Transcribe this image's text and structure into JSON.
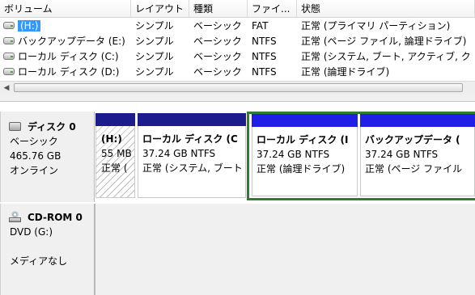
{
  "columns": [
    "ボリューム",
    "レイアウト",
    "種類",
    "ファイ...",
    "状態"
  ],
  "volumes": [
    {
      "name": "(H:)",
      "layout": "シンプル",
      "type": "ベーシック",
      "fs": "FAT",
      "status": "正常 (プライマリ パーティション)",
      "selected": true
    },
    {
      "name": "バックアップデータ (E:)",
      "layout": "シンプル",
      "type": "ベーシック",
      "fs": "NTFS",
      "status": "正常 (ページ ファイル, 論理ドライブ)"
    },
    {
      "name": "ローカル ディスク (C:)",
      "layout": "シンプル",
      "type": "ベーシック",
      "fs": "NTFS",
      "status": "正常 (システム, ブート, アクティブ, ク"
    },
    {
      "name": "ローカル ディスク (D:)",
      "layout": "シンプル",
      "type": "ベーシック",
      "fs": "NTFS",
      "status": "正常 (論理ドライブ)"
    }
  ],
  "disk0": {
    "title": "ディスク 0",
    "kind": "ベーシック",
    "size": "465.76 GB",
    "state": "オンライン",
    "partitions": [
      {
        "name": "(H:)",
        "size": "55 MB",
        "status": "正常 (",
        "bar": "#1c1c8c",
        "hatched": true
      },
      {
        "name": "ローカル ディスク (C",
        "size": "37.24 GB NTFS",
        "status": "正常 (システム, ブート",
        "bar": "#1c1c8c"
      },
      {
        "name": "ローカル ディスク (I",
        "size": "37.24 GB NTFS",
        "status": "正常 (論理ドライブ)",
        "bar": "#1f1fe6"
      },
      {
        "name": "バックアップデータ (",
        "size": "37.24 GB NTFS",
        "status": "正常 (ページ ファイル",
        "bar": "#1f1fe6"
      }
    ],
    "extended_border_color": "#2e7d32"
  },
  "cdrom": {
    "title": "CD-ROM 0",
    "drive": "DVD (G:)",
    "media": "メディアなし"
  },
  "colors": {
    "selection": "#3399ff",
    "primary_bar": "#1c1c8c",
    "logical_bar": "#1f1fe6"
  }
}
